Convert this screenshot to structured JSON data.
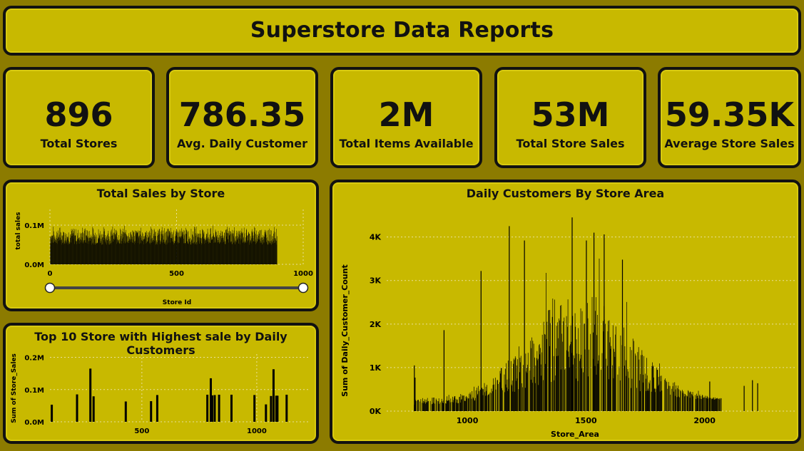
{
  "header": {
    "title": "Superstore Data Reports"
  },
  "kpis": [
    {
      "value": "896",
      "label": "Total Stores"
    },
    {
      "value": "786.35",
      "label": "Avg. Daily Customer"
    },
    {
      "value": "2M",
      "label": "Total Items Available"
    },
    {
      "value": "53M",
      "label": "Total Store Sales"
    },
    {
      "value": "59.35K",
      "label": "Average Store Sales"
    }
  ],
  "colors": {
    "background": "#8c7b00",
    "card": "#c8b900",
    "border": "#111111",
    "bars": "#000000"
  },
  "chart_data": [
    {
      "id": "sales-by-store",
      "type": "bar",
      "title": "Total Sales by Store",
      "xlabel": "Store Id",
      "ylabel": "total sales",
      "xlim": [
        0,
        1000
      ],
      "ylim": [
        0,
        0.14
      ],
      "x_ticks": [
        "0",
        "500",
        "1000"
      ],
      "y_ticks": [
        "0.0M",
        "0.1M"
      ],
      "y_tick_values": [
        0,
        0.1
      ],
      "x_tick_values": [
        0,
        500,
        1000
      ],
      "store_count": 896,
      "typical_range_M": [
        0.05,
        0.1
      ],
      "slider_range": [
        0,
        1000
      ]
    },
    {
      "id": "top10-sales",
      "type": "bar",
      "title": "Top 10 Store with Highest sale by Daily Customers",
      "xlabel": "",
      "ylabel": "Sum of Store_Sales",
      "xlim": [
        100,
        1230
      ],
      "ylim": [
        0,
        0.21
      ],
      "x_ticks": [
        "500",
        "1000"
      ],
      "x_tick_values": [
        500,
        1000
      ],
      "y_ticks": [
        "0.0M",
        "0.1M",
        "0.2M"
      ],
      "y_tick_values": [
        0,
        0.1,
        0.2
      ],
      "x": [
        108,
        218,
        276,
        290,
        430,
        540,
        567,
        785,
        800,
        806,
        817,
        836,
        890,
        990,
        1040,
        1062,
        1073,
        1085,
        1090,
        1130
      ],
      "values": [
        0.053,
        0.085,
        0.165,
        0.079,
        0.063,
        0.064,
        0.083,
        0.084,
        0.135,
        0.082,
        0.083,
        0.084,
        0.084,
        0.083,
        0.054,
        0.08,
        0.163,
        0.081,
        0.081,
        0.084
      ]
    },
    {
      "id": "customers-by-area",
      "type": "bar",
      "title": "Daily Customers By Store Area",
      "xlabel": "Store_Area",
      "ylabel": "Sum of Daily_Customer_Count",
      "xlim": [
        660,
        2380
      ],
      "ylim": [
        0,
        4600
      ],
      "x_ticks": [
        "1000",
        "1500",
        "2000"
      ],
      "x_tick_values": [
        1000,
        1500,
        2000
      ],
      "y_ticks": [
        "0K",
        "1K",
        "2K",
        "3K",
        "4K"
      ],
      "y_tick_values": [
        0,
        1000,
        2000,
        3000,
        4000
      ],
      "area_range": [
        775,
        2229
      ],
      "peaks": [
        {
          "x": 775,
          "y": 1050
        },
        {
          "x": 778,
          "y": 770
        },
        {
          "x": 900,
          "y": 1860
        },
        {
          "x": 1056,
          "y": 3220
        },
        {
          "x": 1175,
          "y": 4250
        },
        {
          "x": 1239,
          "y": 3920
        },
        {
          "x": 1440,
          "y": 4450
        },
        {
          "x": 1500,
          "y": 3920
        },
        {
          "x": 1532,
          "y": 4100
        },
        {
          "x": 1575,
          "y": 4060
        },
        {
          "x": 1652,
          "y": 3480
        },
        {
          "x": 2020,
          "y": 680
        },
        {
          "x": 2165,
          "y": 580
        },
        {
          "x": 2200,
          "y": 710
        },
        {
          "x": 2222,
          "y": 640
        }
      ]
    }
  ]
}
